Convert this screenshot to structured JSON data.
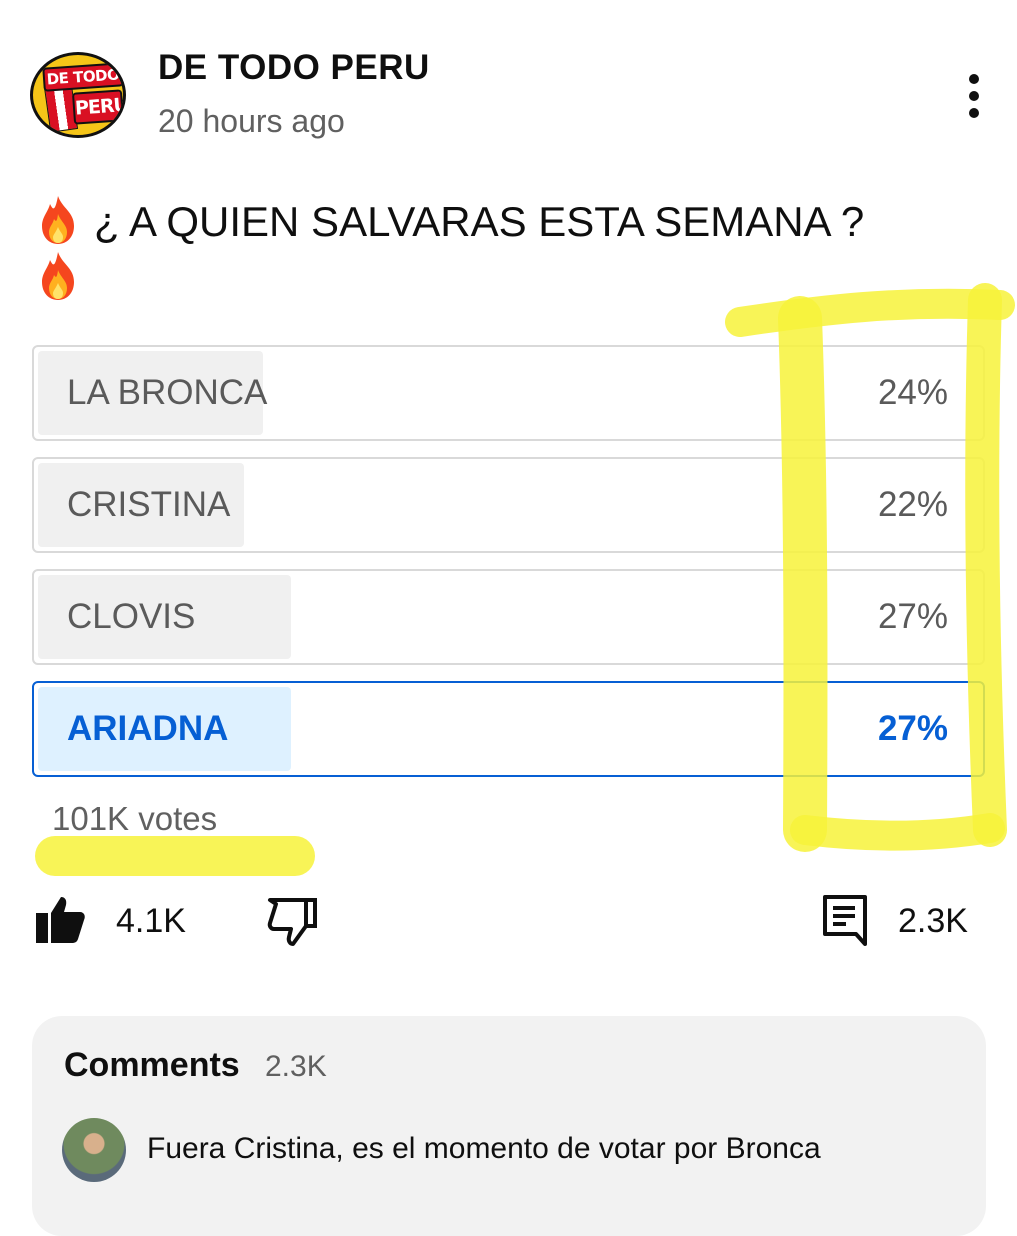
{
  "post": {
    "channel_name": "DE TODO PERU",
    "avatar_text_top": "DE TODO",
    "avatar_text_bottom": "PERU",
    "time_ago": "20 hours ago",
    "question": "¿ A QUIEN SALVARAS ESTA SEMANA ?"
  },
  "poll": {
    "options": [
      {
        "label": "LA BRONCA",
        "percent": "24%",
        "fill_fraction": 0.24,
        "selected": false
      },
      {
        "label": "CRISTINA",
        "percent": "22%",
        "fill_fraction": 0.22,
        "selected": false
      },
      {
        "label": "CLOVIS",
        "percent": "27%",
        "fill_fraction": 0.27,
        "selected": false
      },
      {
        "label": "ARIADNA",
        "percent": "27%",
        "fill_fraction": 0.27,
        "selected": true
      }
    ],
    "votes": "101K votes"
  },
  "actions": {
    "likes": "4.1K",
    "comment_count": "2.3K",
    "like_icon": "thumbs-up-icon",
    "dislike_icon": "thumbs-down-icon",
    "comment_icon": "comment-icon"
  },
  "comments": {
    "title": "Comments",
    "count": "2.3K",
    "top_comment": "Fuera Cristina, es el momento de votar por Bronca"
  },
  "colors": {
    "accent": "#065fd4",
    "selected_fill": "#def1ff",
    "option_fill": "#f0f0f0",
    "highlighter": "#f7f23a"
  }
}
